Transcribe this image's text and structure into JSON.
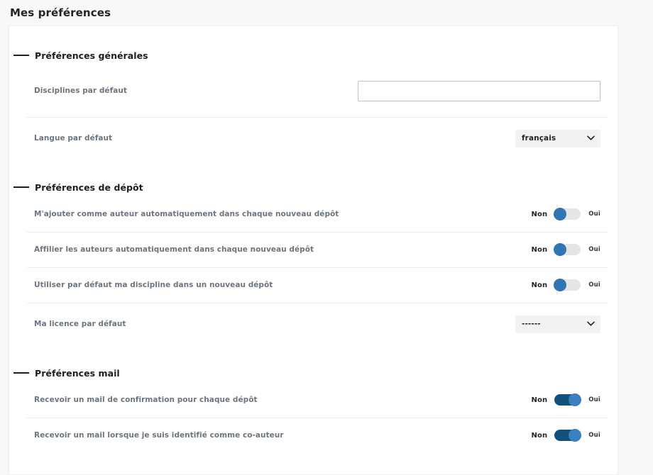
{
  "page": {
    "title": "Mes préférences"
  },
  "sections": [
    {
      "id": "general",
      "title": "Préférences générales",
      "rows": [
        {
          "id": "default-disciplines",
          "label": "Disciplines par défaut",
          "control": "text",
          "value": "",
          "placeholder": ""
        },
        {
          "id": "default-language",
          "label": "Langue par défaut",
          "control": "select",
          "value": "français"
        }
      ]
    },
    {
      "id": "deposit",
      "title": "Préférences de dépôt",
      "rows": [
        {
          "id": "add-me-as-author",
          "label": "M'ajouter comme auteur automatiquement dans chaque nouveau dépôt",
          "control": "toggle",
          "state": "off",
          "off_label": "Non",
          "on_label": "Oui"
        },
        {
          "id": "affiliate-authors",
          "label": "Affilier les auteurs automatiquement dans chaque nouveau dépôt",
          "control": "toggle",
          "state": "off",
          "off_label": "Non",
          "on_label": "Oui"
        },
        {
          "id": "use-my-discipline",
          "label": "Utiliser par défaut ma discipline dans un nouveau dépôt",
          "control": "toggle",
          "state": "off",
          "off_label": "Non",
          "on_label": "Oui"
        },
        {
          "id": "default-license",
          "label": "Ma licence par défaut",
          "control": "select",
          "value": "------"
        }
      ]
    },
    {
      "id": "mail",
      "title": "Préférences mail",
      "rows": [
        {
          "id": "mail-confirmation",
          "label": "Recevoir un mail de confirmation pour chaque dépôt",
          "control": "toggle",
          "state": "on",
          "off_label": "Non",
          "on_label": "Oui"
        },
        {
          "id": "mail-coauthor",
          "label": "Recevoir un mail lorsque je suis identifié comme co-auteur",
          "control": "toggle",
          "state": "on",
          "off_label": "Non",
          "on_label": "Oui"
        }
      ]
    }
  ],
  "colors": {
    "page_background": "#f8f8f8",
    "card_background": "#ffffff",
    "label_text": "#6c757d",
    "heading_text": "#1c1e21",
    "toggle_off_track": "#e6e6e6",
    "toggle_off_knob": "#3076b5",
    "toggle_on_track": "#12507e",
    "toggle_on_knob": "#3a7fc0",
    "input_border": "#b6c2ce",
    "select_background": "#f2f2f2",
    "divider": "#ececec"
  }
}
